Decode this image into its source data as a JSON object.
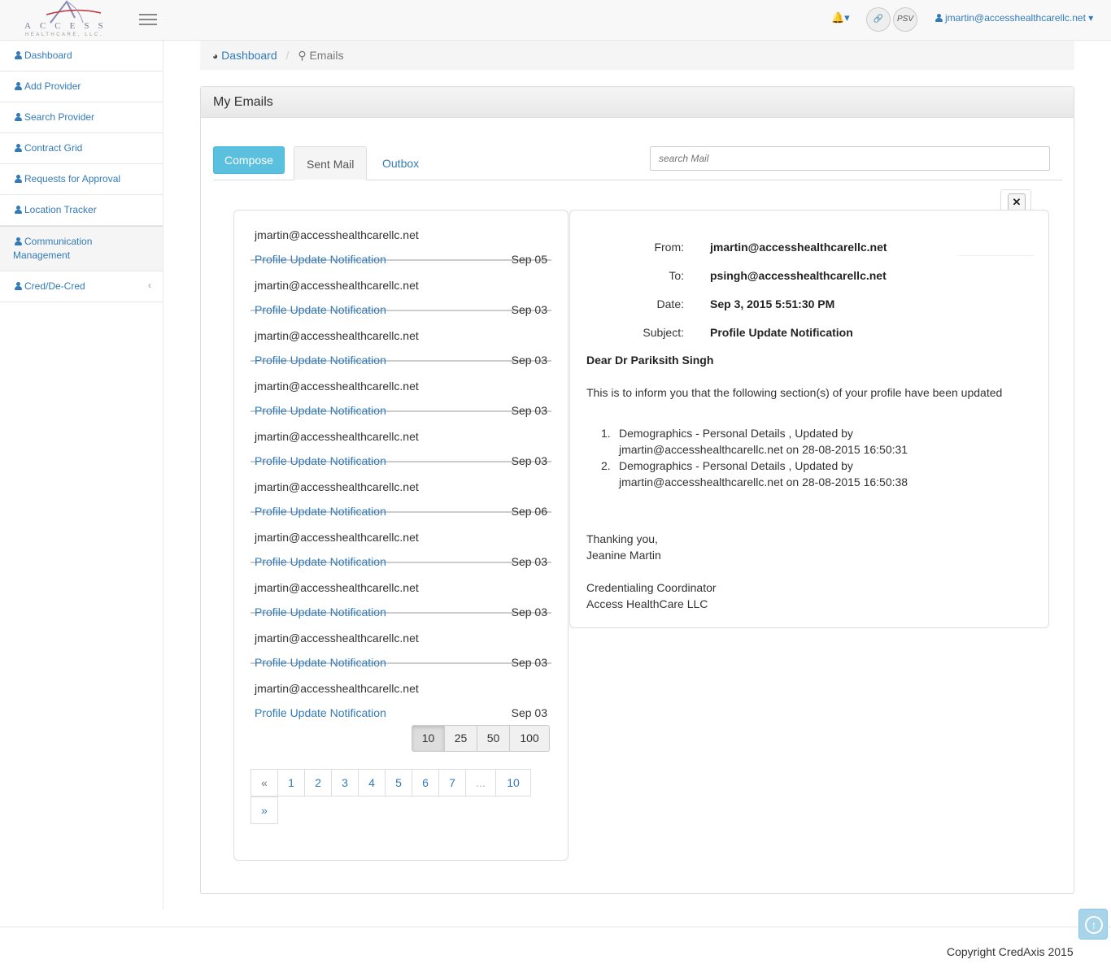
{
  "header": {
    "logo_word": "ACCESS",
    "logo_sub": "HEALTHCARE, LLC.",
    "psv_label": "PSV",
    "user_email": "jmartin@accesshealthcarellc.net"
  },
  "sidebar": {
    "items": [
      {
        "label": "Dashboard"
      },
      {
        "label": "Add Provider"
      },
      {
        "label": "Search Provider"
      },
      {
        "label": "Contract Grid"
      },
      {
        "label": "Requests for Approval"
      },
      {
        "label": "Location Tracker"
      },
      {
        "label": "Communication Management"
      },
      {
        "label": "Cred/De-Cred"
      }
    ]
  },
  "breadcrumb": {
    "home": "Dashboard",
    "current": "Emails"
  },
  "panel": {
    "title": "My Emails",
    "compose_label": "Compose",
    "tabs": [
      {
        "label": "Sent Mail"
      },
      {
        "label": "Outbox"
      }
    ],
    "search_placeholder": "search Mail"
  },
  "mails": [
    {
      "from": "jmartin@accesshealthcarellc.net",
      "subject": "Profile Update Notification",
      "date": "Sep 05"
    },
    {
      "from": "jmartin@accesshealthcarellc.net",
      "subject": "Profile Update Notification",
      "date": "Sep 03"
    },
    {
      "from": "jmartin@accesshealthcarellc.net",
      "subject": "Profile Update Notification",
      "date": "Sep 03"
    },
    {
      "from": "jmartin@accesshealthcarellc.net",
      "subject": "Profile Update Notification",
      "date": "Sep 03"
    },
    {
      "from": "jmartin@accesshealthcarellc.net",
      "subject": "Profile Update Notification",
      "date": "Sep 03"
    },
    {
      "from": "jmartin@accesshealthcarellc.net",
      "subject": "Profile Update Notification",
      "date": "Sep 06"
    },
    {
      "from": "jmartin@accesshealthcarellc.net",
      "subject": "Profile Update Notification",
      "date": "Sep 03"
    },
    {
      "from": "jmartin@accesshealthcarellc.net",
      "subject": "Profile Update Notification",
      "date": "Sep 03"
    },
    {
      "from": "jmartin@accesshealthcarellc.net",
      "subject": "Profile Update Notification",
      "date": "Sep 03"
    },
    {
      "from": "jmartin@accesshealthcarellc.net",
      "subject": "Profile Update Notification",
      "date": "Sep 03"
    }
  ],
  "page_sizes": {
    "options": [
      "10",
      "25",
      "50",
      "100"
    ],
    "selected": "10"
  },
  "pagination": {
    "prev": "«",
    "pages": [
      "1",
      "2",
      "3",
      "4",
      "5",
      "6",
      "7",
      "...",
      "10"
    ],
    "next": "»"
  },
  "detail": {
    "close": "✕",
    "from_label": "From:",
    "from": "jmartin@accesshealthcarellc.net",
    "to_label": "To:",
    "to": "psingh@accesshealthcarellc.net",
    "date_label": "Date:",
    "date": "Sep 3, 2015 5:51:30 PM",
    "subject_label": "Subject:",
    "subject": "Profile Update Notification",
    "greeting": "Dear Dr Pariksith Singh",
    "intro": "This is to inform you that the following section(s) of your profile have been updated",
    "updates": [
      {
        "num": "1.",
        "text": "Demographics - Personal Details , Updated by jmartin@accesshealthcarellc.net on 28-08-2015 16:50:31"
      },
      {
        "num": "2.",
        "text": "Demographics - Personal Details , Updated by jmartin@accesshealthcarellc.net on 28-08-2015 16:50:38"
      }
    ],
    "sign_thanks": "Thanking you,",
    "sign_name": "Jeanine Martin",
    "sign_title": "Credentialing Coordinator",
    "sign_company": "Access HealthCare LLC"
  },
  "footer": {
    "copyright": "Copyright CredAxis 2015"
  },
  "colors": {
    "link": "#337ab7",
    "compose_bg": "#5bc0de",
    "scroll_top": "#a8d4ea"
  }
}
